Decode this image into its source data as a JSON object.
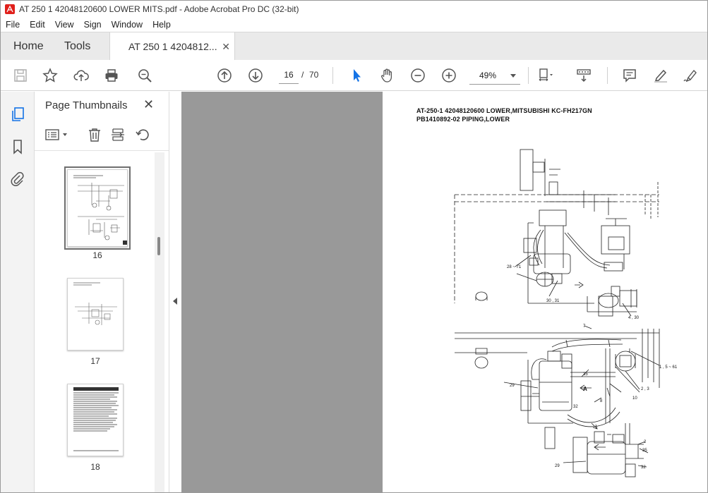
{
  "window": {
    "title": "AT 250 1 42048120600 LOWER MITS.pdf - Adobe Acrobat Pro DC (32-bit)"
  },
  "menu": {
    "items": [
      "File",
      "Edit",
      "View",
      "Sign",
      "Window",
      "Help"
    ]
  },
  "tabs": {
    "home": "Home",
    "tools": "Tools",
    "doc": "AT 250 1 4204812...",
    "close": "✕"
  },
  "toolbar": {
    "page_current": "16",
    "page_sep": "/",
    "page_total": "70",
    "zoom": "49%"
  },
  "thumbnails": {
    "title": "Page Thumbnails",
    "close": "✕",
    "pages": [
      {
        "label": "16",
        "selected": true
      },
      {
        "label": "17",
        "selected": false
      },
      {
        "label": "18",
        "selected": false
      }
    ]
  },
  "document": {
    "header_line1": "AT-250-1 42048120600 LOWER,MITSUBISHI KC-FH217GN",
    "header_line2": "PB1410892-02 PIPING,LOWER",
    "callouts": [
      "28 ~ 71",
      "30 , 31",
      "4 , 30",
      "7",
      "1 , 5 ~ 61",
      "35",
      "2 , 3",
      "29",
      "A",
      "32",
      "8",
      "10",
      "2",
      "35",
      "29",
      "32"
    ]
  },
  "colors": {
    "accent": "#1473e6",
    "panel_bg": "#f3f3f3",
    "doc_bg": "#999999"
  }
}
